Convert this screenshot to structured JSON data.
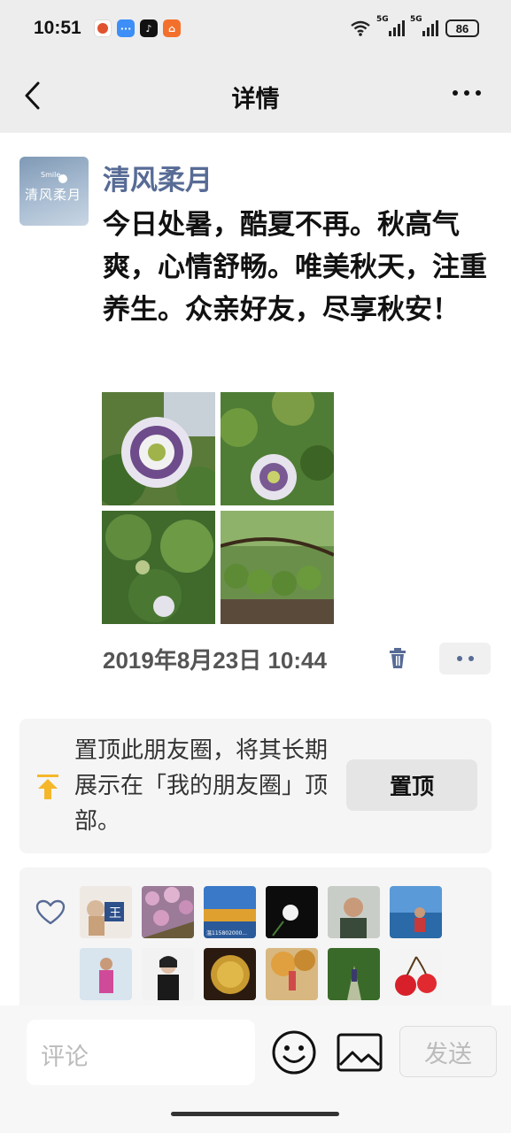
{
  "status_bar": {
    "time": "10:51",
    "signal_1": "5G",
    "signal_2": "5G",
    "battery": "86"
  },
  "nav": {
    "title": "详情"
  },
  "post": {
    "username": "清风柔月",
    "text": "今日处暑，酷夏不再。秋高气爽，心情舒畅。唯美秋天，注重养生。众亲好友，尽享秋安！",
    "timestamp": "2019年8月23日 10:44",
    "avatar_text": "清风柔月",
    "avatar_small_text": "Smile"
  },
  "pin_card": {
    "text": "置顶此朋友圈，将其长期展示在「我的朋友圈」顶部。",
    "button_label": "置顶"
  },
  "likes": {
    "count_visible": 12,
    "avatar_badge": "王",
    "avatar_caption": "温115802000..."
  },
  "comment_bar": {
    "placeholder": "评论",
    "send_label": "发送"
  },
  "colors": {
    "username": "#576b95",
    "header_bg": "#ededed",
    "pin_icon": "#f5b729"
  }
}
